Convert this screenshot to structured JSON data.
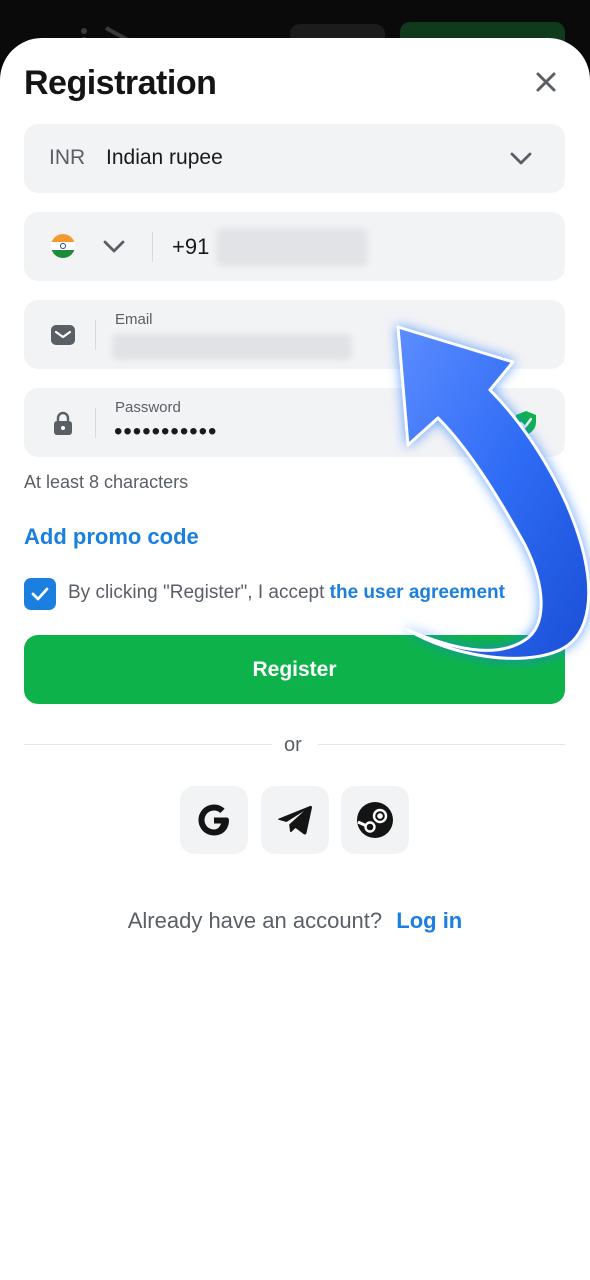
{
  "modal": {
    "title": "Registration"
  },
  "currency": {
    "code": "INR",
    "name": "Indian rupee"
  },
  "phone": {
    "country_flag": "india-flag-icon",
    "prefix": "+91"
  },
  "email": {
    "label": "Email"
  },
  "password": {
    "label": "Password",
    "masked_value": "•••••••••••",
    "hint": "At least 8 characters"
  },
  "promo": {
    "label": "Add promo code"
  },
  "agreement": {
    "checked": true,
    "text": "By clicking \"Register\", I accept",
    "link": "the user agreement"
  },
  "register_button": {
    "label": "Register"
  },
  "divider": {
    "text": "or"
  },
  "social": [
    {
      "icon": "google-icon"
    },
    {
      "icon": "telegram-icon"
    },
    {
      "icon": "steam-icon"
    }
  ],
  "footer": {
    "prompt": "Already have an account?",
    "login_label": "Log in"
  },
  "colors": {
    "accent_blue": "#1b7fe0",
    "register_green": "#0db34a",
    "field_bg": "#f2f3f5"
  }
}
